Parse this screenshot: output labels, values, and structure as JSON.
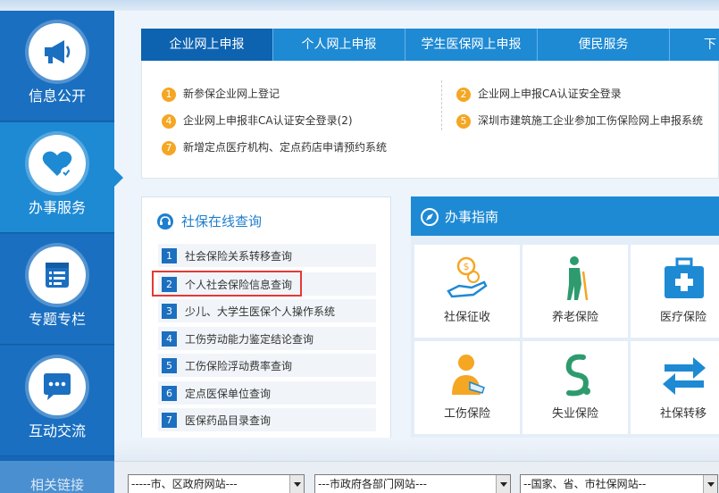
{
  "sidebar": {
    "items": [
      {
        "label": "信息公开"
      },
      {
        "label": "办事服务"
      },
      {
        "label": "专题专栏"
      },
      {
        "label": "互动交流"
      }
    ],
    "bottom_label": "相关链接"
  },
  "tabs": [
    {
      "label": "企业网上申报"
    },
    {
      "label": "个人网上申报"
    },
    {
      "label": "学生医保网上申报"
    },
    {
      "label": "便民服务"
    },
    {
      "label": "下"
    }
  ],
  "tab_panel": {
    "items": [
      {
        "num": "1",
        "text": "新参保企业网上登记"
      },
      {
        "num": "2",
        "text": "企业网上申报CA认证安全登录"
      },
      {
        "num": "4",
        "text": "企业网上申报非CA认证安全登录(2)"
      },
      {
        "num": "5",
        "text": "深圳市建筑施工企业参加工伤保险网上申报系统"
      },
      {
        "num": "7",
        "text": "新增定点医疗机构、定点药店申请预约系统"
      }
    ]
  },
  "query": {
    "title": "社保在线查询",
    "items": [
      {
        "num": "1",
        "text": "社会保险关系转移查询"
      },
      {
        "num": "2",
        "text": "个人社会保险信息查询"
      },
      {
        "num": "3",
        "text": "少儿、大学生医保个人操作系统"
      },
      {
        "num": "4",
        "text": "工伤劳动能力鉴定结论查询"
      },
      {
        "num": "5",
        "text": "工伤保险浮动费率查询"
      },
      {
        "num": "6",
        "text": "定点医保单位查询"
      },
      {
        "num": "7",
        "text": "医保药品目录查询"
      }
    ]
  },
  "guide": {
    "title": "办事指南",
    "items": [
      {
        "label": "社保征收"
      },
      {
        "label": "养老保险"
      },
      {
        "label": "医疗保险"
      },
      {
        "label": "工伤保险"
      },
      {
        "label": "失业保险"
      },
      {
        "label": "社保转移"
      }
    ]
  },
  "selects": [
    {
      "value": "-----市、区政府网站---"
    },
    {
      "value": "---市政府各部门网站---"
    },
    {
      "value": "--国家、省、市社保网站--"
    }
  ],
  "colors": {
    "primary": "#1e8ad4",
    "sidebar": "#1a6fc0",
    "accent": "#f5a623",
    "highlight": "#e53935"
  }
}
